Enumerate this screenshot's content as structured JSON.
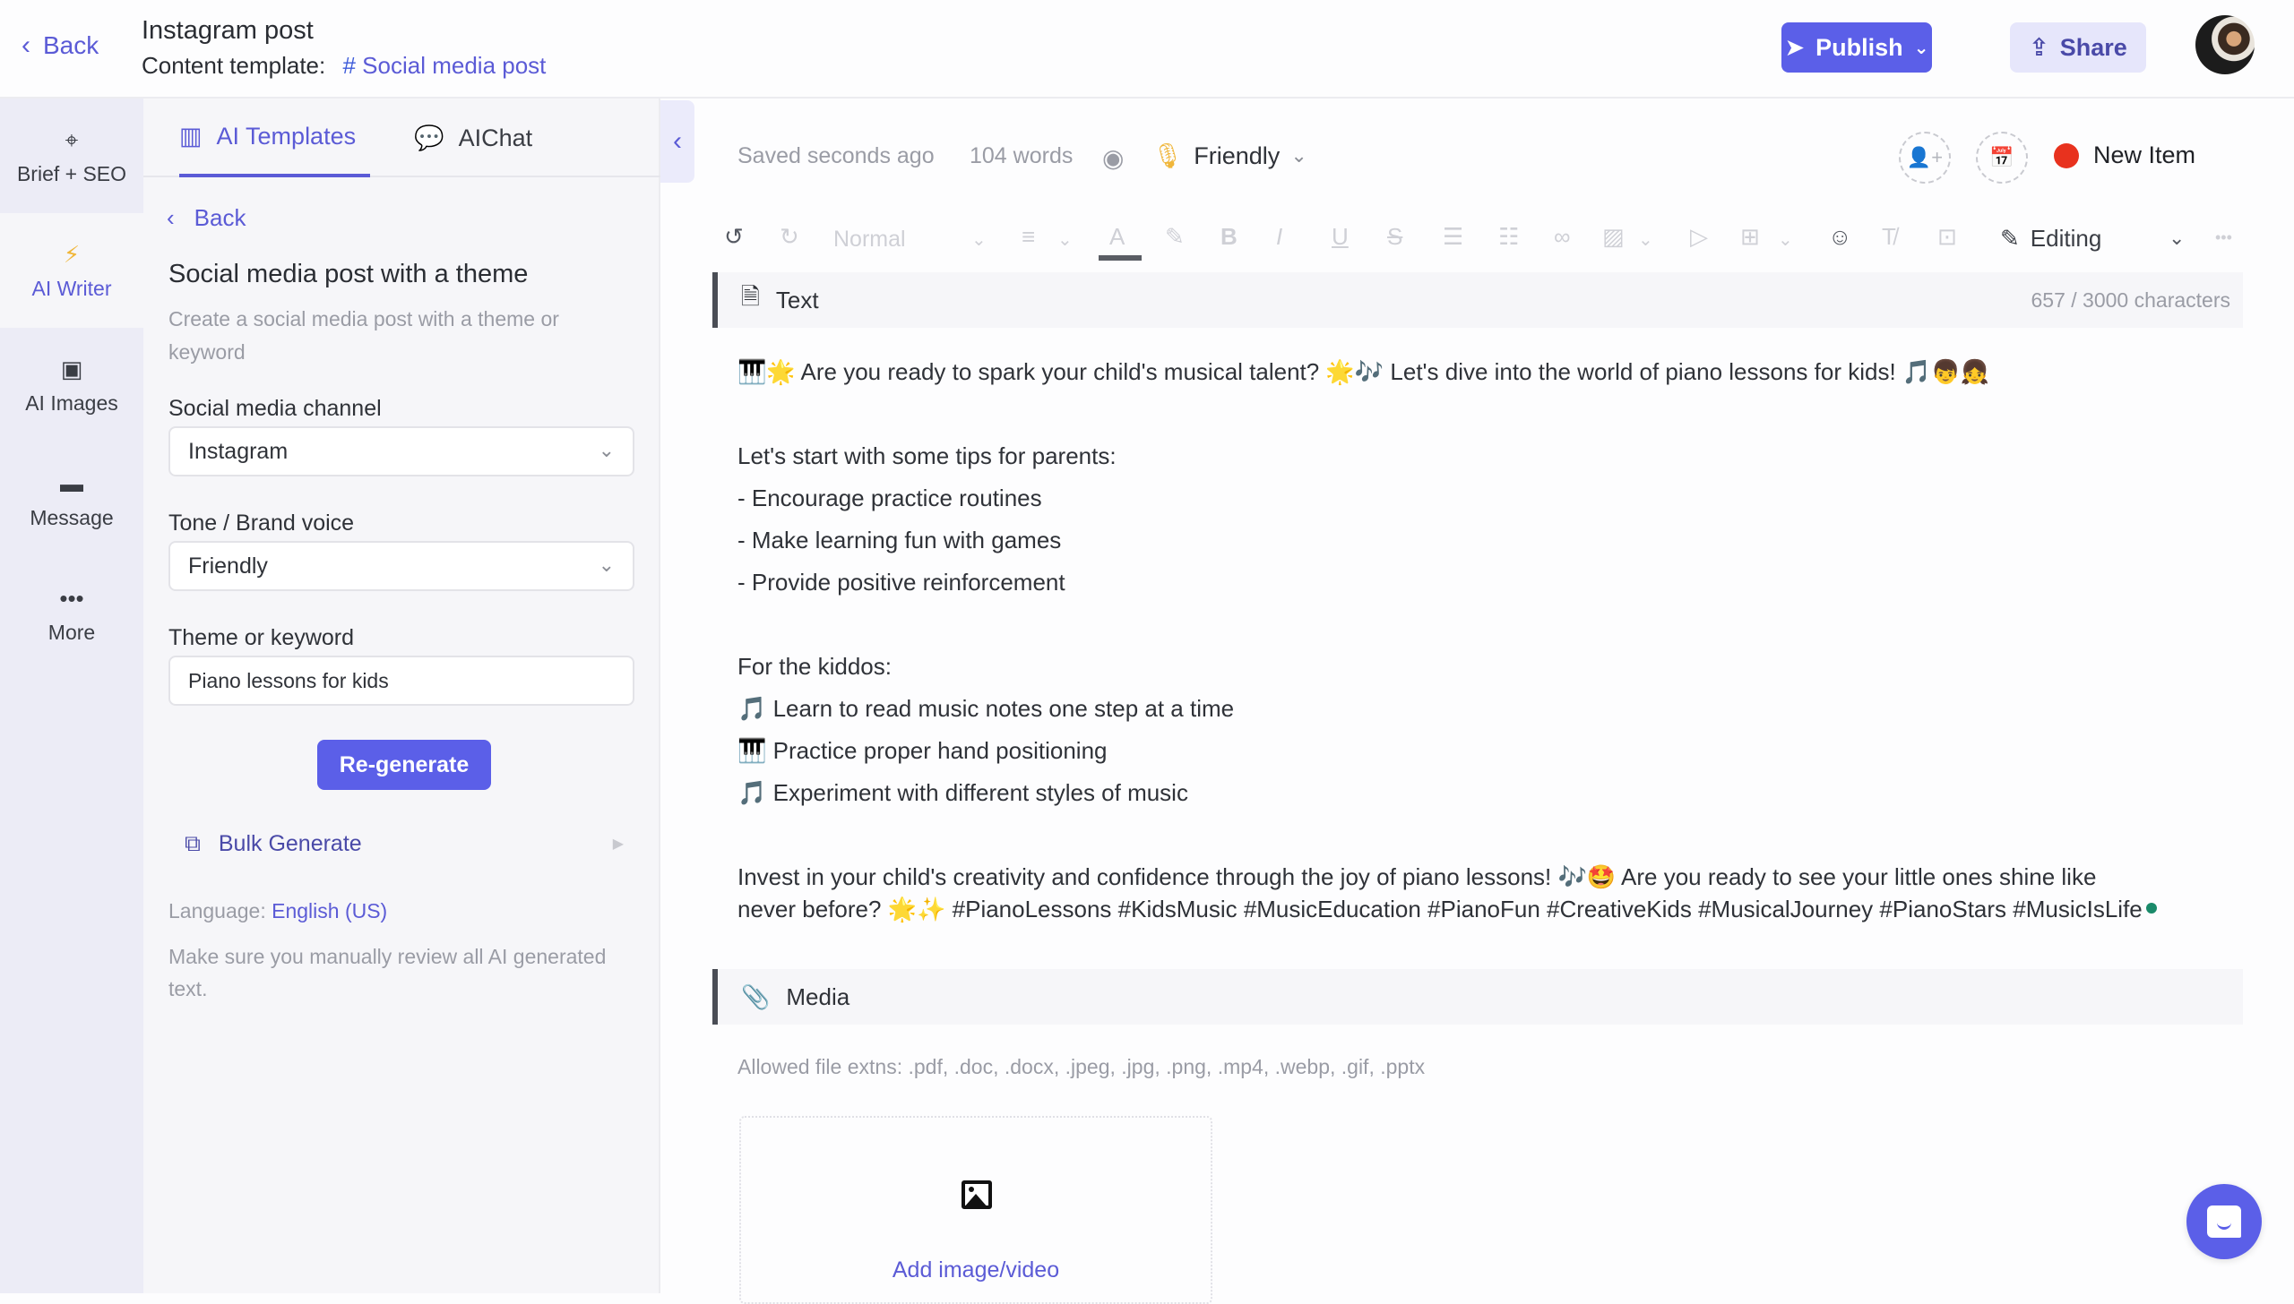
{
  "header": {
    "back_label": "Back",
    "title": "Instagram post",
    "content_template_label": "Content template:",
    "template_hash": "#",
    "template_name": "Social media post",
    "publish_label": "Publish",
    "share_label": "Share"
  },
  "leftnav": {
    "items": [
      {
        "label": "Brief + SEO",
        "icon": "crosshair-icon"
      },
      {
        "label": "AI Writer",
        "icon": "lightning-icon",
        "active": true
      },
      {
        "label": "AI Images",
        "icon": "image-icon"
      },
      {
        "label": "Message",
        "icon": "message-icon"
      },
      {
        "label": "More",
        "icon": "more-icon"
      }
    ]
  },
  "aipanel": {
    "tabs": [
      {
        "label": "AI Templates",
        "active": true
      },
      {
        "label": "AIChat"
      }
    ],
    "back_label": "Back",
    "template_title": "Social media post with a theme",
    "template_desc": "Create a social media post with a theme or keyword",
    "fields": {
      "channel_label": "Social media channel",
      "channel_value": "Instagram",
      "tone_label": "Tone / Brand voice",
      "tone_value": "Friendly",
      "theme_label": "Theme or keyword",
      "theme_value": "Piano lessons for kids"
    },
    "regenerate_label": "Re-generate",
    "bulk_label": "Bulk Generate",
    "language_label": "Language:",
    "language_value": "English (US)",
    "review_note": "Make sure you manually review all AI generated text."
  },
  "editor": {
    "saved_status": "Saved seconds ago",
    "word_count": "104 words",
    "tone": "Friendly",
    "item_status": "New Item",
    "item_status_color": "#e8321e",
    "toolbar": {
      "style_select": "Normal",
      "mode": "Editing"
    },
    "text_section": {
      "title": "Text",
      "char_count": "657 / 3000 characters",
      "lines": [
        "🎹🌟 Are you ready to spark your child's musical talent? 🌟🎶 Let's dive into the world of piano lessons for kids! 🎵👦👧",
        "Let's start with some tips for parents:",
        "- Encourage practice routines",
        "- Make learning fun with games",
        "- Provide positive reinforcement",
        "For the kiddos:",
        "🎵 Learn to read music notes one step at a time",
        "🎹 Practice proper hand positioning",
        "🎵 Experiment with different styles of music",
        "Invest in your child's creativity and confidence through the joy of piano lessons! 🎶🤩 Are you ready to see your little ones shine like",
        "never before? 🌟✨ #PianoLessons #KidsMusic #MusicEducation #PianoFun #CreativeKids #MusicalJourney #PianoStars #MusicIsLife"
      ]
    },
    "media_section": {
      "title": "Media",
      "allowed": "Allowed file extns: .pdf, .doc, .docx, .jpeg, .jpg, .png, .mp4, .webp, .gif, .pptx",
      "add_label": "Add image/video"
    }
  }
}
